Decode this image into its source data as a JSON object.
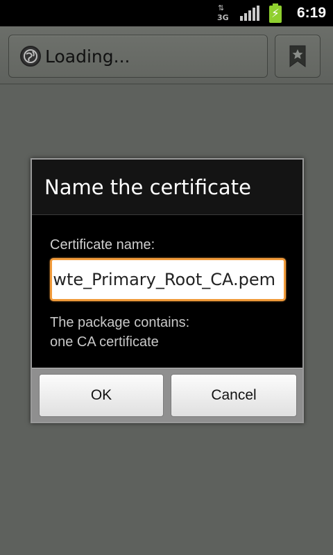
{
  "status_bar": {
    "network_label": "3G",
    "network_arrows": "⇅",
    "time": "6:19",
    "colors": {
      "battery": "#8fcf2f"
    },
    "icons": [
      "network-3g-icon",
      "signal-strength-icon",
      "battery-charging-icon"
    ]
  },
  "browser": {
    "url_text": "Loading...",
    "icons": {
      "page": "globe-icon",
      "bookmark": "bookmark-icon"
    }
  },
  "dialog": {
    "title": "Name the certificate",
    "field_label": "Certificate name:",
    "field_value": "wte_Primary_Root_CA.pem",
    "info_line_1": "The package contains:",
    "info_line_2": "one CA certificate",
    "ok_label": "OK",
    "cancel_label": "Cancel",
    "colors": {
      "input_focus": "#f19b3b"
    }
  }
}
